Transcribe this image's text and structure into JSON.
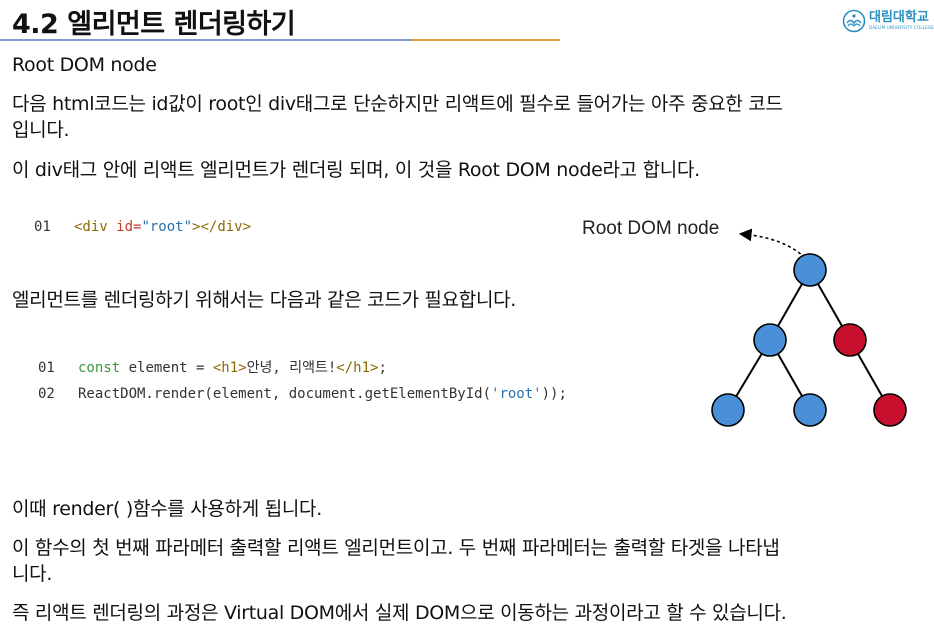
{
  "header": {
    "title": "4.2 엘리먼트 렌더링하기",
    "logo_ko": "대림대학교",
    "logo_en": "DAELIM UNIVERSITY COLLEGE",
    "colors": {
      "blue_rule": "#7b9bd1",
      "orange_rule": "#e0a23a",
      "logo": "#2a8fbf"
    }
  },
  "content": {
    "heading": "Root DOM node",
    "p1_line1": "다음 html코드는 id값이 root인 div태그로 단순하지만 리액트에 필수로 들어가는 아주 중요한 코드",
    "p1_line2": "입니다.",
    "p2": "이 div태그 안에 리액트 엘리먼트가 렌더링 되며, 이 것을 Root DOM node라고 합니다.",
    "p3": "엘리먼트를 렌더링하기 위해서는 다음과 같은 코드가 필요합니다.",
    "p4": "이때 render( )함수를 사용하게 됩니다.",
    "p5_line1": "이 함수의 첫 번째 파라메터 출력할 리액트 엘리먼트이고. 두 번째 파라메터는 출력할 타겟을 나타냅",
    "p5_line2": "니다.",
    "p6": "즉 리액트 렌더링의 과정은 Virtual DOM에서 실제 DOM으로 이동하는 과정이라고 할 수 있습니다."
  },
  "code1": {
    "line_no": "01",
    "open": "<div ",
    "attr": "id=",
    "val": "\"root\"",
    "close": "></div>"
  },
  "code2": {
    "l1_no": "01",
    "l1_kw": "const",
    "l1_mid": " element = ",
    "l1_open": "<h1>",
    "l1_text": "안녕, 리액트!",
    "l1_close": "</h1>",
    "l1_end": ";",
    "l2_no": "02",
    "l2_a": "ReactDOM.render(element, document.getElementById(",
    "l2_str": "'root'",
    "l2_b": "));"
  },
  "diagram": {
    "label": "Root DOM node",
    "colors": {
      "blue_node": "#4a90d9",
      "red_node": "#c8102e",
      "edge": "#000000"
    }
  }
}
